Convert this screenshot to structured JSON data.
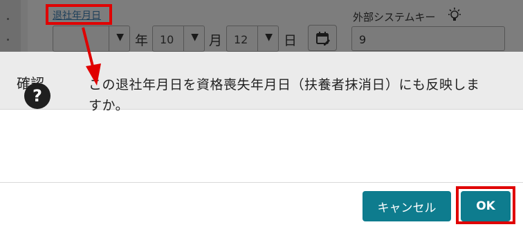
{
  "form": {
    "date_label": "退社年月日",
    "year_value": "",
    "year_unit": "年",
    "month_value": "10",
    "month_unit": "月",
    "day_value": "12",
    "day_unit": "日",
    "external_key_label": "外部システムキー",
    "external_key_value": "9"
  },
  "dialog": {
    "title": "確認",
    "message": "この退社年月日を資格喪失年月日（扶養者抹消日）にも反映しますか。",
    "cancel_label": "キャンセル",
    "ok_label": "OK"
  },
  "colors": {
    "button_bg": "#0e7c8e",
    "highlight_red": "#e00000",
    "overlay": "#777777"
  },
  "icons": [
    "dropdown-arrow-icon",
    "calendar-edit-icon",
    "lightbulb-icon",
    "question-circle-icon"
  ]
}
